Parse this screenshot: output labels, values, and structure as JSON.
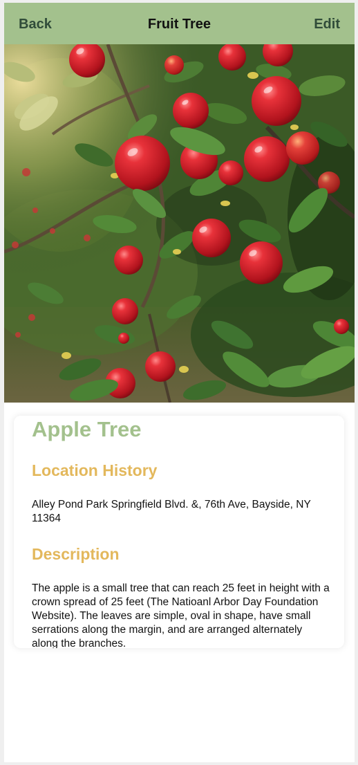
{
  "navbar": {
    "back_label": "Back",
    "title": "Fruit Tree",
    "edit_label": "Edit",
    "background_color": "#a3c18d"
  },
  "hero": {
    "icon": "apple-tree-photo"
  },
  "detail": {
    "name": "Apple Tree",
    "location_heading": "Location History",
    "location_text": "Alley Pond Park Springfield Blvd. &, 76th Ave, Bayside, NY 11364",
    "description_heading": "Description",
    "description_text": "The apple is a small tree that can reach 25 feet in height with a crown spread of 25 feet (The Natioanl Arbor Day Foundation Website). The leaves are simple, oval in shape, have small serrations along the margin, and are arranged alternately along the branches."
  },
  "colors": {
    "title_green": "#a3c18d",
    "heading_gold": "#e3b85c",
    "nav_text": "#304c39"
  }
}
